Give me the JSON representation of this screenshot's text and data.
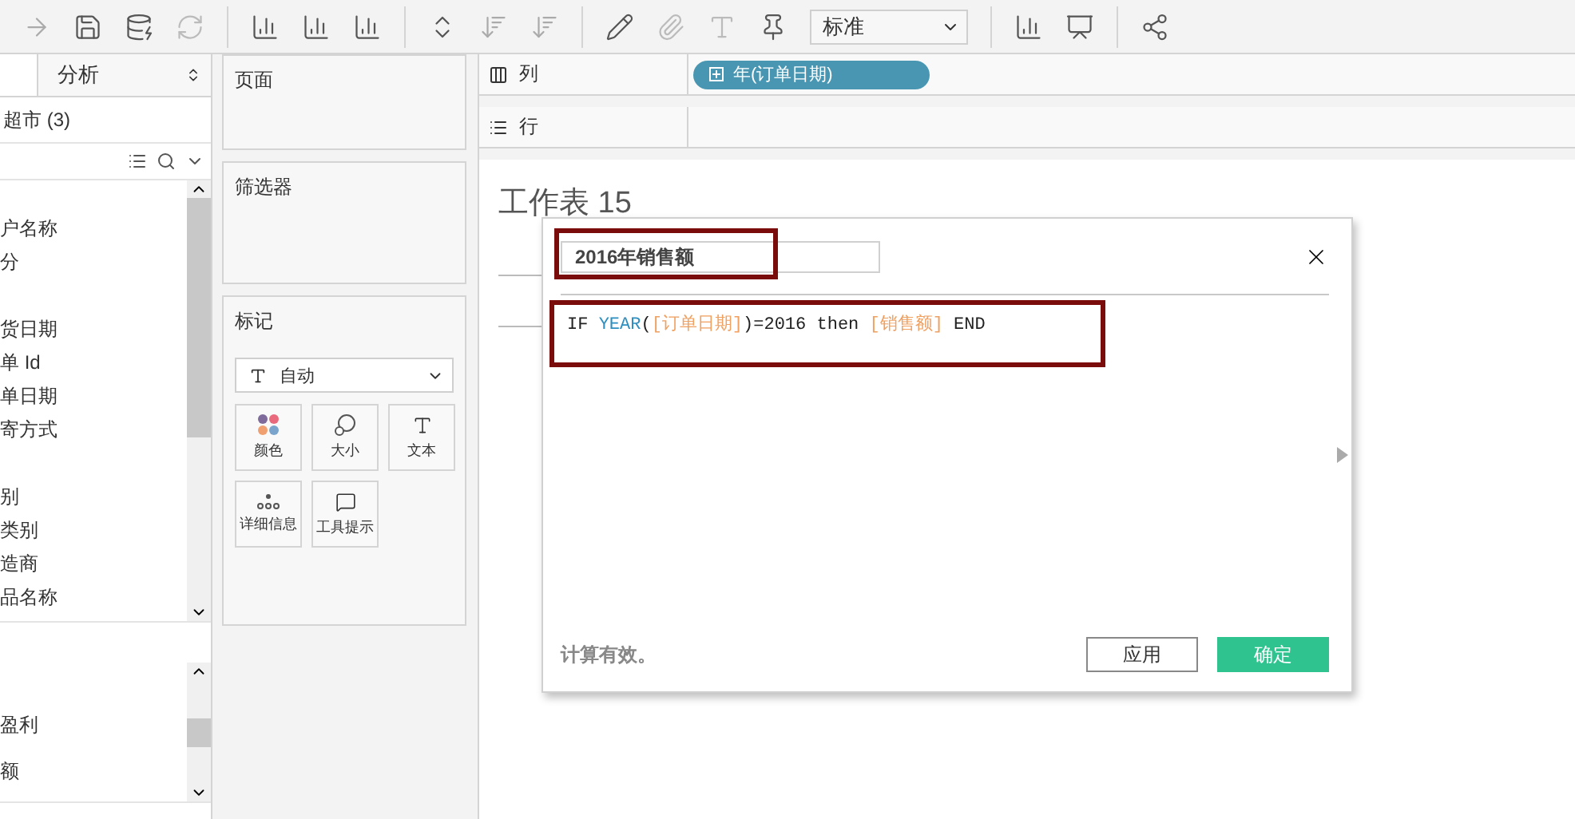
{
  "toolbar": {
    "view_select": "标准"
  },
  "data_pane": {
    "tab": "分析",
    "source": "超市 (3)",
    "dimension_groups": [
      {
        "items": [
          "户名称",
          "分"
        ]
      },
      {
        "items": [
          "货日期",
          "单 Id",
          "单日期",
          "寄方式"
        ]
      },
      {
        "items": [
          "别",
          "类别",
          "造商",
          "品名称"
        ]
      }
    ],
    "measures": [
      "盈利",
      "额"
    ]
  },
  "pages_card": {
    "title": "页面"
  },
  "filters_card": {
    "title": "筛选器"
  },
  "marks_card": {
    "title": "标记",
    "mark_type": "自动",
    "buttons": [
      {
        "label": "颜色",
        "kind": "color"
      },
      {
        "label": "大小",
        "kind": "size"
      },
      {
        "label": "文本",
        "kind": "text"
      },
      {
        "label": "详细信息",
        "kind": "detail"
      },
      {
        "label": "工具提示",
        "kind": "tooltip"
      }
    ]
  },
  "shelves": [
    {
      "label": "列",
      "kind": "columns",
      "pills": [
        "年(订单日期)"
      ]
    },
    {
      "label": "行",
      "kind": "rows"
    }
  ],
  "worksheet": {
    "title": "工作表 15"
  },
  "calc_dialog": {
    "name": "2016年销售额",
    "formula": [
      {
        "text": "IF ",
        "kind": "keyword"
      },
      {
        "text": "YEAR",
        "kind": "function"
      },
      {
        "text": "(",
        "kind": "plain"
      },
      {
        "text": "[订单日期]",
        "kind": "field"
      },
      {
        "text": ")=2016 then ",
        "kind": "plain"
      },
      {
        "text": "[销售额]",
        "kind": "field"
      },
      {
        "text": " END",
        "kind": "plain"
      }
    ],
    "status": "计算有效。",
    "apply": "应用",
    "ok": "确定"
  }
}
